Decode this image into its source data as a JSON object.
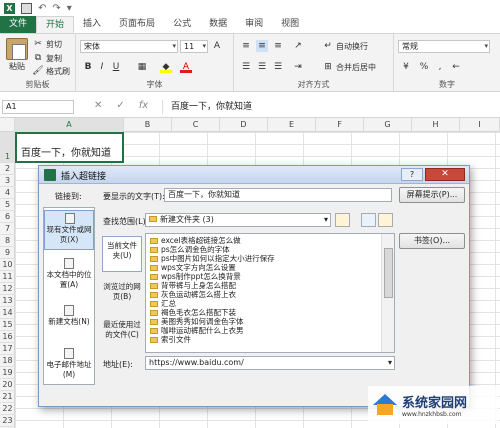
{
  "quick_access": {
    "undo_glyph": "↶",
    "redo_glyph": "↷",
    "more_glyph": "▾"
  },
  "tabs": [
    "文件",
    "开始",
    "插入",
    "页面布局",
    "公式",
    "数据",
    "审阅",
    "视图"
  ],
  "ribbon": {
    "clipboard": {
      "paste": "粘贴",
      "cut": "剪切",
      "copy": "复制",
      "format_painter": "格式刷",
      "label": "剪贴板"
    },
    "font": {
      "name": "宋体",
      "size": "11",
      "label": "字体"
    },
    "alignment": {
      "wrap": "自动换行",
      "merge": "合并后居中",
      "label": "对齐方式"
    },
    "number": {
      "format": "常规",
      "label": "数字"
    }
  },
  "formula_bar": {
    "cell_ref": "A1",
    "content": "百度一下，你就知道"
  },
  "columns": [
    "A",
    "B",
    "C",
    "D",
    "E",
    "F",
    "G",
    "H",
    "I"
  ],
  "rows": [
    "1",
    "2",
    "3",
    "4",
    "5",
    "6",
    "7",
    "8",
    "9",
    "10",
    "11",
    "12",
    "13",
    "14",
    "15",
    "16",
    "17",
    "18",
    "19",
    "20",
    "21",
    "22",
    "23",
    "24"
  ],
  "cell_a1": "百度一下，你就知道",
  "dialog": {
    "title": "插入超链接",
    "help": "?",
    "close": "✕",
    "link_to_label": "链接到:",
    "display_text_label": "要显示的文字(T):",
    "display_text": "百度一下，你就知道",
    "screen_tip": "屏幕提示(P)...",
    "look_in_label": "查找范围(L):",
    "look_in_value": "新建文件夹 (3)",
    "bookmark": "书签(O)...",
    "link_targets": [
      "现有文件或网页(X)",
      "本文档中的位置(A)",
      "新建文档(N)",
      "电子邮件地址(M)"
    ],
    "sub_nav": [
      "当前文件夹(U)",
      "浏览过的网页(B)",
      "最近使用过的文件(C)"
    ],
    "files": [
      "excel表格超链接怎么做",
      "ps怎么调金色的字体",
      "ps中图片如何以指定大小进行保存",
      "wps文字方向怎么设置",
      "wps制作ppt怎么换背景",
      "背带裤与上身怎么搭配",
      "灰色运动裤怎么搭上衣",
      "汇总",
      "褐色毛衣怎么搭配下装",
      "美图秀秀如何调金色字体",
      "咖啡运动裤配什么上衣男",
      "索引文件"
    ],
    "address_label": "地址(E):",
    "address": "https://www.baidu.com/"
  },
  "watermark": {
    "brand": "系统家园网",
    "url": "www.hnzkhbsb.com"
  }
}
